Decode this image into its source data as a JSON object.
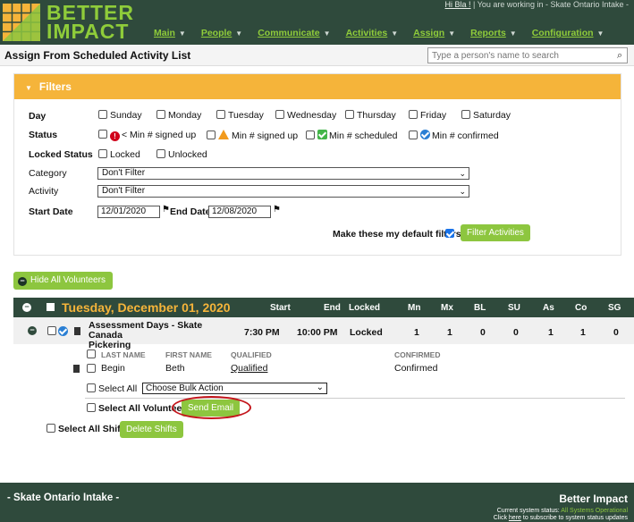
{
  "header": {
    "logo_line1": "BETTER",
    "logo_line2": "IMPACT",
    "greeting": "Hi Bla !",
    "working_in": "You are working in - Skate Ontario Intake -",
    "nav": [
      {
        "label": "Main"
      },
      {
        "label": "People"
      },
      {
        "label": "Communicate"
      },
      {
        "label": "Activities"
      },
      {
        "label": "Assign"
      },
      {
        "label": "Reports"
      },
      {
        "label": "Configuration"
      }
    ]
  },
  "subbar": {
    "title": "Assign From Scheduled Activity List",
    "search_placeholder": "Type a person's name to search"
  },
  "filters": {
    "title": "Filters",
    "day_label": "Day",
    "days": [
      "Sunday",
      "Monday",
      "Tuesday",
      "Wednesday",
      "Thursday",
      "Friday",
      "Saturday"
    ],
    "status_label": "Status",
    "status_options": [
      "< Min # signed up",
      "Min # signed up",
      "Min # scheduled",
      "Min # confirmed"
    ],
    "locked_label": "Locked Status",
    "locked_options": [
      "Locked",
      "Unlocked"
    ],
    "category_label": "Category",
    "category_value": "Don't Filter",
    "activity_label": "Activity",
    "activity_value": "Don't Filter",
    "start_label": "Start Date",
    "start_value": "12/01/2020",
    "end_label": "End Date",
    "end_value": "12/08/2020",
    "default_label": "Make these my default filters",
    "filter_button": "Filter Activities"
  },
  "hide_button": "Hide All Volunteers",
  "day_group": {
    "title": "Tuesday, December 01, 2020",
    "columns": [
      "Start",
      "End",
      "Locked",
      "Mn",
      "Mx",
      "BL",
      "SU",
      "As",
      "Co",
      "SG"
    ]
  },
  "shift": {
    "name_line1": "Assessment Days - Skate Canada",
    "name_line2": "Pickering",
    "start": "7:30 PM",
    "end": "10:00 PM",
    "locked": "Locked",
    "mn": "1",
    "mx": "1",
    "bl": "0",
    "su": "0",
    "as": "1",
    "co": "1",
    "sg": "0"
  },
  "volunteers": {
    "headers": [
      "LAST NAME",
      "FIRST NAME",
      "QUALIFIED",
      "CONFIRMED"
    ],
    "rows": [
      {
        "last": "Begin",
        "first": "Beth",
        "qualified": "Qualified",
        "confirmed": "Confirmed"
      }
    ],
    "select_all": "Select All",
    "bulk_action": "Choose Bulk Action",
    "select_all_volunteers": "Select All Volunteers",
    "send_email": "Send Email"
  },
  "shifts_footer": {
    "select_all_shifts": "Select All Shifts",
    "delete_shifts": "Delete Shifts"
  },
  "footer": {
    "org": "- Skate Ontario Intake -",
    "brand": "Better Impact",
    "status_prefix": "Current system status:",
    "status_value": "All Systems Operational",
    "subscribe_pre": "Click",
    "subscribe_link": "here",
    "subscribe_post": "to subscribe to system status updates"
  }
}
